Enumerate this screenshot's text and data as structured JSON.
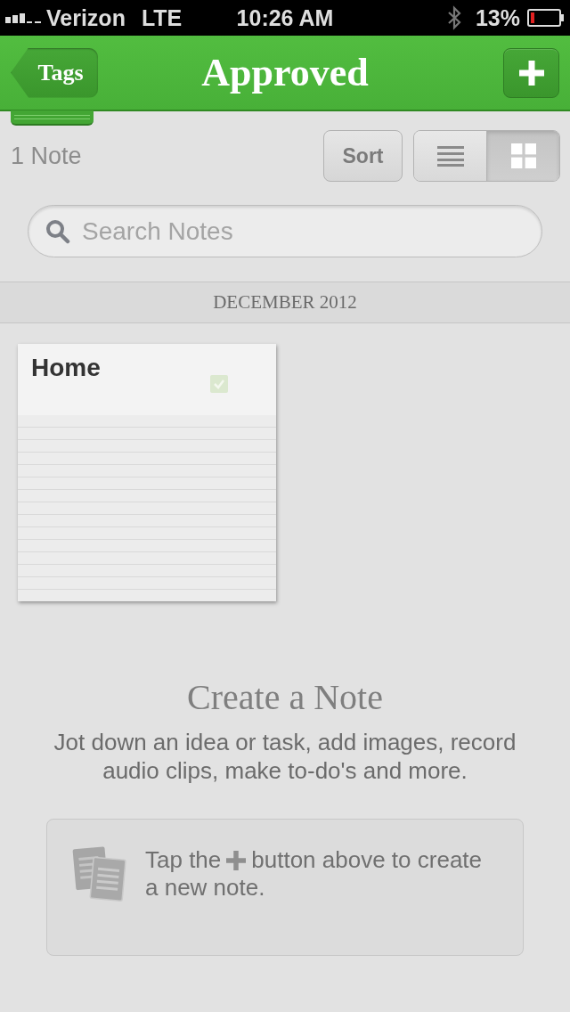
{
  "status_bar": {
    "carrier": "Verizon",
    "network": "LTE",
    "time": "10:26 AM",
    "battery_percent": "13%"
  },
  "nav_bar": {
    "back_button": "Tags",
    "title": "Approved"
  },
  "toolbar": {
    "note_count": "1 Note",
    "sort_button": "Sort",
    "views": [
      {
        "kind": "list",
        "selected": false
      },
      {
        "kind": "grid",
        "selected": true
      }
    ]
  },
  "search": {
    "placeholder": "Search Notes"
  },
  "sections": [
    {
      "header": "DECEMBER 2012",
      "notes": [
        {
          "title": "Home"
        }
      ]
    }
  ],
  "empty_state": {
    "title": "Create a Note",
    "description": "Jot down an idea or task, add images, record audio clips, make to-do's and more.",
    "tip": {
      "text_before": "Tap the",
      "text_after": "button above to create",
      "text_continued": "a new note."
    }
  }
}
